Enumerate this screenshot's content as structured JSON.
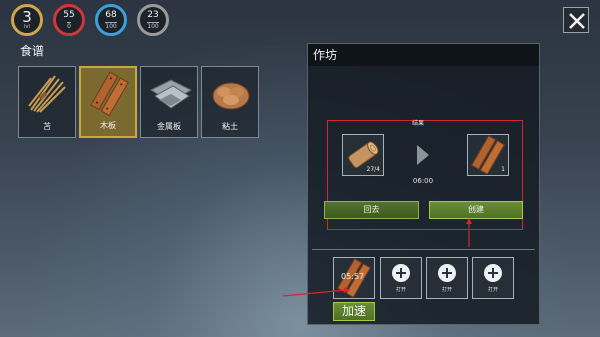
{
  "stats": {
    "level": {
      "value": "3",
      "label": "lvl"
    },
    "health": {
      "value": "55",
      "sub": "0"
    },
    "water": {
      "value": "68",
      "sub": "100"
    },
    "food": {
      "value": "23",
      "sub": "100"
    }
  },
  "recipes": {
    "title": "食谱",
    "items": [
      {
        "label": "苫",
        "icon": "straw-bundle-icon"
      },
      {
        "label": "木板",
        "icon": "wooden-plank-icon",
        "selected": true
      },
      {
        "label": "金属板",
        "icon": "metal-sheet-icon"
      },
      {
        "label": "粘土",
        "icon": "clay-icon"
      }
    ]
  },
  "workshop": {
    "title": "作坊",
    "result_label": "结果",
    "input": {
      "icon": "log-icon",
      "qty": "27/4"
    },
    "output": {
      "icon": "wooden-plank-icon",
      "qty": "1"
    },
    "time": "06:00",
    "back_button": "回去",
    "create_button": "创建",
    "queue": [
      {
        "icon": "wooden-plank-icon",
        "timer": "05:57",
        "qty": "1"
      },
      {
        "icon": "plus-icon",
        "label": "打开"
      },
      {
        "icon": "plus-icon",
        "label": "打开"
      },
      {
        "icon": "plus-icon",
        "label": "打开"
      }
    ],
    "speed_button": "加速"
  },
  "colors": {
    "annotation_red": "#d8242a",
    "selected_gold": "#c9a93a",
    "button_green": "#4e7126"
  }
}
